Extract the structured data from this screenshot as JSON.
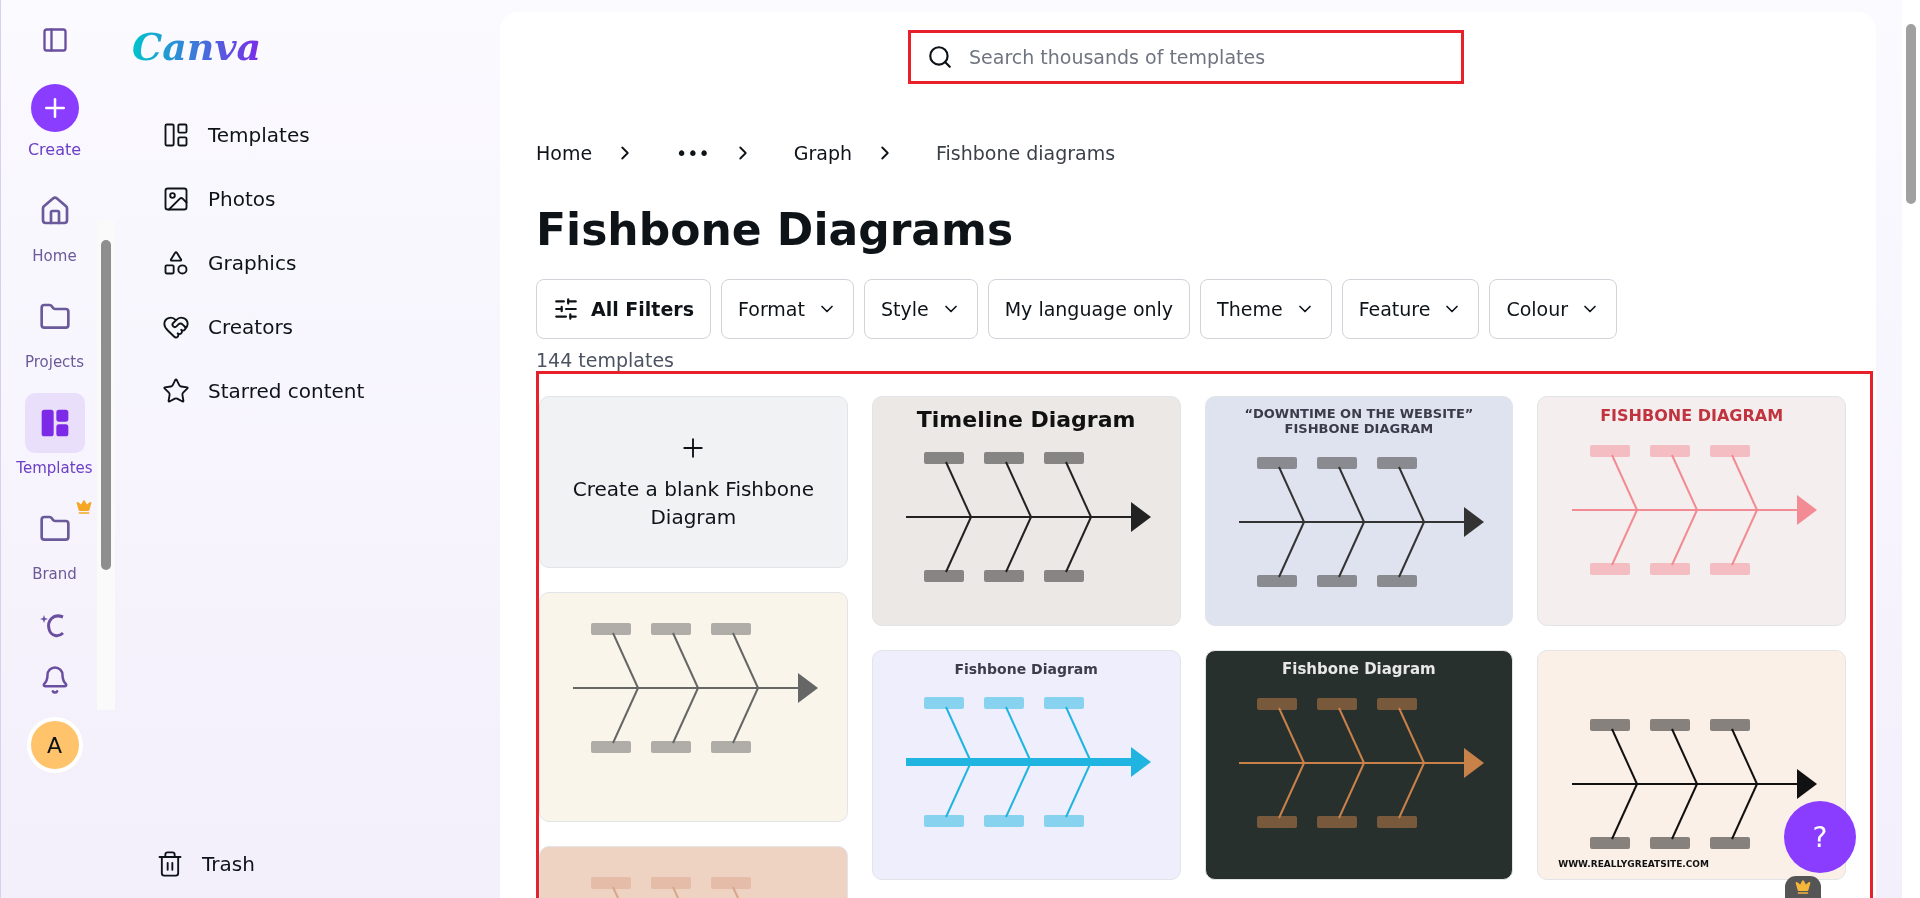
{
  "rail": {
    "create_label": "Create",
    "items": [
      {
        "label": "Home",
        "kind": "home",
        "selected": false,
        "crown": false
      },
      {
        "label": "Projects",
        "kind": "projects",
        "selected": false,
        "crown": false
      },
      {
        "label": "Templates",
        "kind": "templates",
        "selected": true,
        "crown": false
      },
      {
        "label": "Brand",
        "kind": "brand",
        "selected": false,
        "crown": true
      }
    ],
    "avatar": "A"
  },
  "logo": "Canva",
  "sidebar": {
    "items": [
      {
        "label": "Templates",
        "kind": "templates"
      },
      {
        "label": "Photos",
        "kind": "photos"
      },
      {
        "label": "Graphics",
        "kind": "graphics"
      },
      {
        "label": "Creators",
        "kind": "creators"
      },
      {
        "label": "Starred content",
        "kind": "starred"
      }
    ],
    "trash": "Trash"
  },
  "search": {
    "placeholder": "Search thousands of templates"
  },
  "breadcrumb": [
    "Home",
    "•••",
    "Graph",
    "Fishbone diagrams"
  ],
  "heading": "Fishbone Diagrams",
  "filters": [
    {
      "label": "All Filters",
      "kind": "all"
    },
    {
      "label": "Format",
      "kind": "dropdown"
    },
    {
      "label": "Style",
      "kind": "dropdown"
    },
    {
      "label": "My language only",
      "kind": "toggle"
    },
    {
      "label": "Theme",
      "kind": "dropdown"
    },
    {
      "label": "Feature",
      "kind": "dropdown"
    },
    {
      "label": "Colour",
      "kind": "dropdown"
    }
  ],
  "count": "144 templates",
  "columns": [
    [
      {
        "kind": "blank",
        "title": "Create a blank Fishbone Diagram"
      },
      {
        "kind": "cream"
      },
      {
        "kind": "peach"
      }
    ],
    [
      {
        "kind": "timeline",
        "title": "Timeline Diagram"
      },
      {
        "kind": "lavender",
        "title": "Fishbone Diagram"
      }
    ],
    [
      {
        "kind": "pastel",
        "title": "“DOWNTIME ON THE WEBSITE” FISHBONE DIAGRAM"
      },
      {
        "kind": "dark",
        "title": "Fishbone Diagram"
      }
    ],
    [
      {
        "kind": "pink",
        "title": "FISHBONE DIAGRAM"
      },
      {
        "kind": "blue",
        "title": "WWW.REALLYGREATSITE.COM"
      }
    ]
  ],
  "help": "?"
}
